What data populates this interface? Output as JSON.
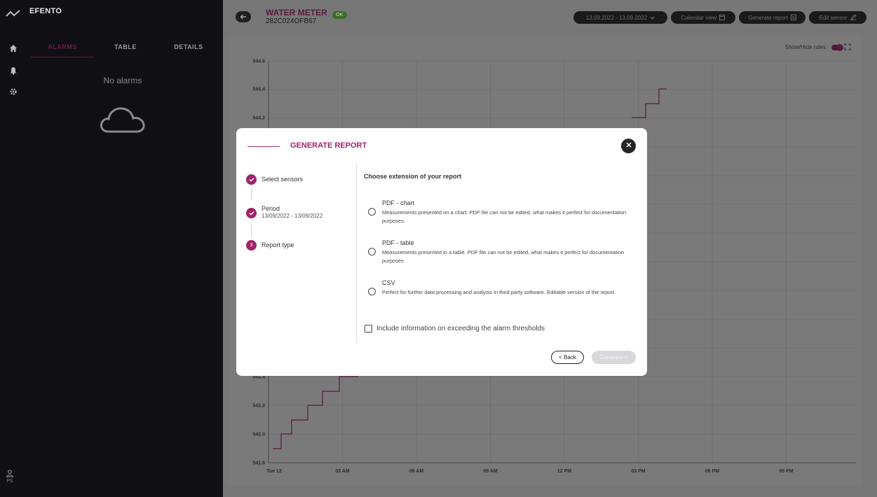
{
  "app": {
    "brand": "EFENTO",
    "user_initials": "PS"
  },
  "sidebar": {
    "tabs": [
      {
        "label": "ALARMS"
      },
      {
        "label": "TABLE"
      },
      {
        "label": "DETAILS"
      }
    ],
    "empty_text": "No alarms"
  },
  "header": {
    "sensor_name": "WATER METER",
    "sensor_id": "282C024OFB67",
    "status": "OK",
    "date_range": "13.09.2022 - 13.09.2022",
    "calendar_label": "Calendar view",
    "report_label": "Generate report",
    "edit_label": "Edit sensor"
  },
  "chart_controls": {
    "toggle_label": "Show/Hide rules"
  },
  "chart_data": {
    "type": "line",
    "x_ticks": [
      "Tue 13",
      "03 AM",
      "06 AM",
      "09 AM",
      "12 PM",
      "03 PM",
      "06 PM",
      "09 PM"
    ],
    "y_ticks": [
      "541.8",
      "542.0",
      "542.2",
      "542.4",
      "544.2",
      "544.4",
      "544.6"
    ],
    "series": [
      {
        "color": "#5b1840",
        "visible_points": [
          [
            "Tue 13",
            541.9
          ],
          [
            "Tue 13",
            542.0
          ],
          [
            "Tue 13",
            542.1
          ],
          [
            "Tue 13",
            542.2
          ],
          [
            "Tue 13",
            542.3
          ],
          [
            "03 AM",
            542.4
          ],
          [
            "03 PM",
            544.2
          ],
          [
            "03 PM",
            544.3
          ],
          [
            "03 PM",
            544.4
          ]
        ]
      }
    ]
  },
  "modal": {
    "title": "GENERATE REPORT",
    "steps": [
      {
        "label": "Select sensors",
        "sub": "",
        "done": true
      },
      {
        "label": "Period",
        "sub": "13/09/2022 - 13/09/2022",
        "done": true
      },
      {
        "label": "Report type",
        "sub": "",
        "number": "3"
      }
    ],
    "choose_title": "Choose extension of your report",
    "options": [
      {
        "title": "PDF - chart",
        "desc": "Measurements presented on a chart. PDF file can not be edited, what makes it perfect for documentation purposes."
      },
      {
        "title": "PDF - table",
        "desc": "Measurements presented in a table. PDF file can not be edited, what makes it perfect for documentation purposes"
      },
      {
        "title": "CSV",
        "desc": "Perfect for further data processing and analysis in third party software. Editable version of the report."
      }
    ],
    "checkbox_label": "Include information on exceeding the alarm thresholds",
    "back_label": "< Back",
    "generate_label": "Generate >"
  }
}
